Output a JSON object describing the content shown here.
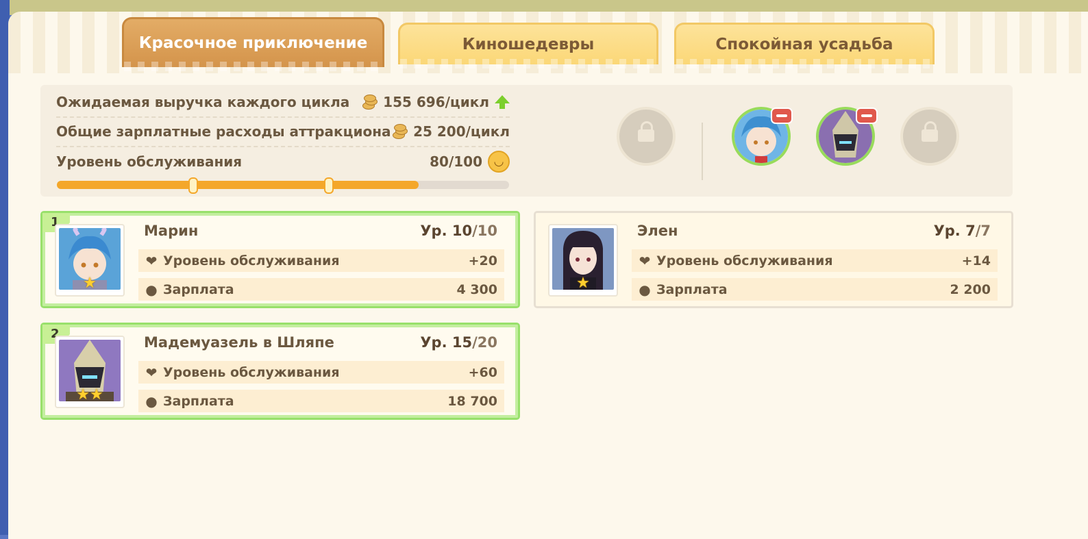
{
  "tabs": [
    {
      "label": "Красочное приключение",
      "active": true
    },
    {
      "label": "Киношедевры",
      "active": false
    },
    {
      "label": "Спокойная усадьба",
      "active": false
    }
  ],
  "summary": {
    "revenue_label": "Ожидаемая выручка каждого цикла",
    "revenue_value": "155 696/цикл",
    "salary_label": "Общие зарплатные расходы аттракциона",
    "salary_value": "25 200/цикл",
    "service_label": "Уровень обслуживания",
    "service_value": "80/100",
    "service_progress": 0.8
  },
  "staff_slots": [
    {
      "state": "locked"
    },
    {
      "state": "filled",
      "character": "Марин"
    },
    {
      "state": "filled",
      "character": "Мадемуазель в Шляпе"
    },
    {
      "state": "locked"
    }
  ],
  "cards": [
    {
      "badge": "1",
      "name": "Марин",
      "level_prefix": "Ур. ",
      "level": "10",
      "level_max": "/10",
      "service_label": "Уровень обслуживания",
      "service": "+20",
      "salary_label": "Зарплата",
      "salary": "4 300",
      "stars": "★",
      "selected": true
    },
    {
      "badge": "",
      "name": "Элен",
      "level_prefix": "Ур. ",
      "level": "7",
      "level_max": "/7",
      "service_label": "Уровень обслуживания",
      "service": "+14",
      "salary_label": "Зарплата",
      "salary": "2 200",
      "stars": "★",
      "selected": false
    },
    {
      "badge": "2",
      "name": "Мадемуазель в Шляпе",
      "level_prefix": "Ур. ",
      "level": "15",
      "level_max": "/20",
      "service_label": "Уровень обслуживания",
      "service": "+60",
      "salary_label": "Зарплата",
      "salary": "18 700",
      "stars": "★★",
      "selected": true
    }
  ],
  "icons": {
    "coin": "coin-icon",
    "heart": "heart-icon",
    "lock": "lock-icon",
    "remove": "remove-icon",
    "up": "up-arrow-icon",
    "smile": "smile-icon"
  },
  "colors": {
    "accent_orange": "#f4a72a",
    "selected_green": "#98e06b",
    "active_tab": "#d4944b",
    "inactive_tab": "#fbd777"
  }
}
